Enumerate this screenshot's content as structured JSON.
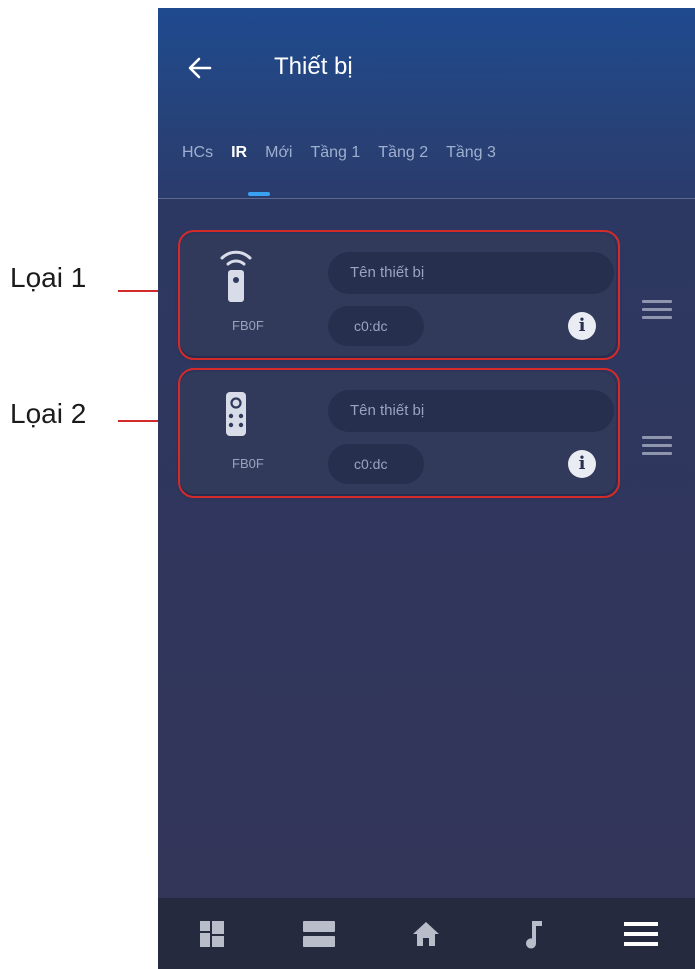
{
  "annotations": [
    {
      "label": "Lọai 1"
    },
    {
      "label": "Lọai 2"
    }
  ],
  "header": {
    "title": "Thiết bị",
    "back_icon": "arrow-left-icon"
  },
  "tabs": [
    {
      "label": "HCs",
      "active": false
    },
    {
      "label": "IR",
      "active": true
    },
    {
      "label": "Mới",
      "active": false
    },
    {
      "label": "Tầng 1",
      "active": false
    },
    {
      "label": "Tầng 2",
      "active": false
    },
    {
      "label": "Tầng 3",
      "active": false
    }
  ],
  "devices": [
    {
      "icon": "ir-remote-wifi-icon",
      "code": "FB0F",
      "name_placeholder": "Tên thiết bị",
      "mac": "c0:dc",
      "info_icon": "info-icon",
      "handle_icon": "drag-handle-icon"
    },
    {
      "icon": "ir-remote-buttons-icon",
      "code": "FB0F",
      "name_placeholder": "Tên thiết bị",
      "mac": "c0:dc",
      "info_icon": "info-icon",
      "handle_icon": "drag-handle-icon"
    }
  ],
  "bottom_nav": [
    {
      "icon": "dashboard-icon"
    },
    {
      "icon": "rooms-icon"
    },
    {
      "icon": "home-icon"
    },
    {
      "icon": "music-icon"
    },
    {
      "icon": "menu-icon"
    }
  ],
  "colors": {
    "accent": "#3aa0f0",
    "annotation": "#d42a2a",
    "card": "#323a5c",
    "pill": "#272f4f"
  }
}
